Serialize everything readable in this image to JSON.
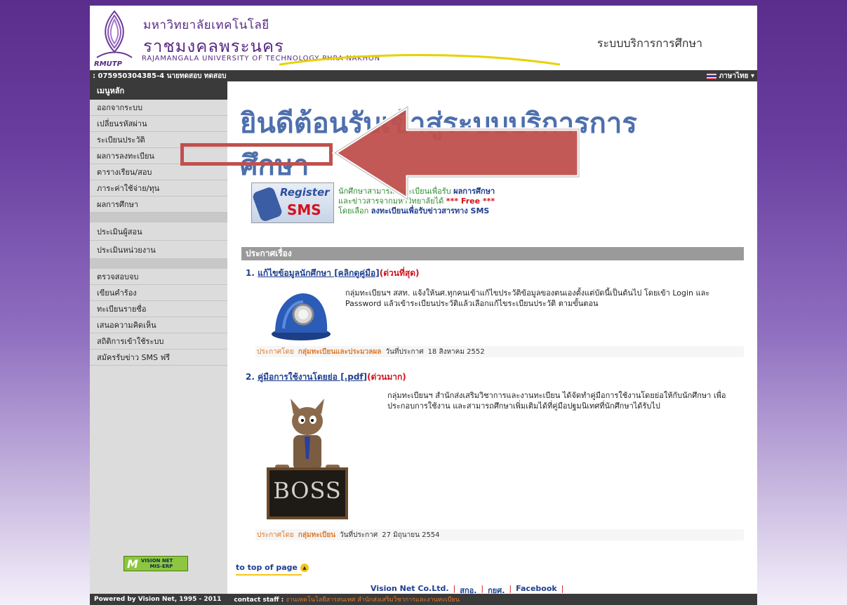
{
  "header": {
    "uni_thai_line1": "มหาวิทยาลัยเทคโนโลยี",
    "uni_thai_line2": "ราชมงคลพระนคร",
    "uni_english": "RAJAMANGALA UNIVERSITY   OF TECHNOLOGY PHRA NAKHON",
    "logo_abbr": "RMUTP",
    "system_title": "ระบบบริการการศึกษา"
  },
  "userbar": {
    "user_info": ": 075950304385-4 นายทดสอบ ทดสอบ",
    "language": "ภาษาไทย ▾"
  },
  "sidebar": {
    "title": "เมนูหลัก",
    "group1": [
      "ออกจากระบบ",
      "เปลี่ยนรหัสผ่าน",
      "ระเบียนประวัติ",
      "ผลการลงทะเบียน",
      "ตารางเรียน/สอบ",
      "ภาระค่าใช้จ่าย/ทุน",
      "ผลการศึกษา"
    ],
    "group2": [
      "ประเมินผู้สอน",
      "ประเมินหน่วยงาน"
    ],
    "group3": [
      "ตรวจสอบจบ",
      "เขียนคำร้อง",
      "ทะเบียนรายชื่อ",
      "เสนอความคิดเห็น",
      "สถิติการเข้าใช้ระบบ",
      "สมัครรับข่าว SMS ฟรี"
    ],
    "mis_logo_m": "M",
    "mis_logo_line1": "VISION NET",
    "mis_logo_line2": "MIS-ERP"
  },
  "content": {
    "welcome": "ยินดีต้อนรับเข้าสู่ระบบบริการการศึกษา",
    "sms_badge_register": "Register",
    "sms_badge_sms": "SMS",
    "sms_line1_a": "นักศึกษาสามารถลงทะเบียนเพื่อรับ",
    "sms_line1_b": "ผลการศึกษา",
    "sms_line2_a": "และข่าวสารจากมหาวิทยาลัยได้",
    "sms_line2_b": "*** Free ***",
    "sms_line3_a": "โดยเลือก",
    "sms_line3_b": "ลงทะเบียนเพื่อรับข่าวสารทาง SMS",
    "news_header": "ประกาศเรื่อง",
    "news": [
      {
        "number": "1.",
        "title": "แก้ไขข้อมูลนักศึกษา [คลิกดูคู่มือ]",
        "tag": "(ด่วนที่สุด)",
        "body": "กลุ่มทะเบียนฯ สสท. แจ้งให้นศ.ทุกคนเข้าแก้ไขประวัติข้อมูลของตนเองตั้งแต่บัดนี้เป็นต้นไป โดยเข้า Login และ Password แล้วเข้าระเบียนประวัติแล้วเลือกแก้ไขระเบียนประวัติ ตามขั้นตอน",
        "posted_by_label": "ประกาศโดย",
        "posted_by": "กลุ่มทะเบียนและประมวลผล",
        "date_label": "วันที่ประกาศ",
        "date": "18 สิงหาคม 2552"
      },
      {
        "number": "2.",
        "title": "คู่มือการใช้งานโดยย่อ [.pdf]",
        "tag": "(ด่วนมาก)",
        "body": "กลุ่มทะเบียนฯ สำนักส่งเสริมวิชาการและงานทะเบียน ได้จัดทำคู่มือการใช้งานโดยย่อให้กับนักศึกษา เพื่อประกอบการใช้งาน และสามารถศึกษาเพิ่มเติมได้ที่คู่มือปฐมนิเทศที่นักศึกษาได้รับไป",
        "posted_by_label": "ประกาศโดย",
        "posted_by": "กลุ่มทะเบียน",
        "date_label": "วันที่ประกาศ",
        "date": "27 มิถุนายน 2554",
        "image_text": "BOSS"
      }
    ],
    "to_top": "to top of page",
    "footer_links": [
      "Vision Net Co.Ltd.",
      "สกอ.",
      "กยศ.",
      "Facebook"
    ]
  },
  "bottombar": {
    "powered_by": "Powered by Vision Net, 1995 - 2011",
    "contact_label": "contact staff :",
    "contact_value": "งานเทคโนโลยีสารสนเทศ สำนักส่งเสริมวิชาการและงานทะเบียน"
  },
  "colors": {
    "highlight_red": "#c0504d",
    "purple_brand": "#5a2a86",
    "welcome_blue": "#4d6fae"
  }
}
